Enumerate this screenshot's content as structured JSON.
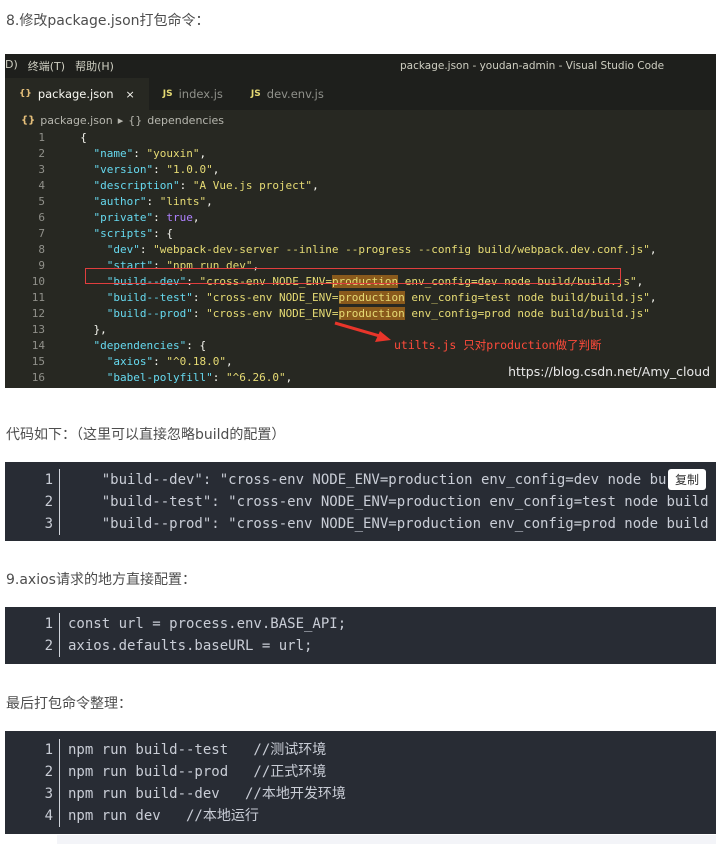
{
  "heading8": "8.修改package.json打包命令：",
  "vscode": {
    "menu": [
      "D)",
      "终端(T)",
      "帮助(H)"
    ],
    "window_title": "package.json - youdan-admin - Visual Studio Code",
    "tabs": [
      {
        "icon": "{}",
        "label": "package.json",
        "close": "×"
      },
      {
        "icon": "JS",
        "label": "index.js"
      },
      {
        "icon": "JS",
        "label": "dev.env.js"
      }
    ],
    "breadcrumb": {
      "file": "package.json",
      "sep": "▸",
      "node": "dependencies",
      "node_icon": "{}"
    },
    "line_numbers": [
      "1",
      "2",
      "3",
      "4",
      "5",
      "6",
      "7",
      "8",
      "9",
      "10",
      "11",
      "12",
      "13",
      "14",
      "15",
      "16"
    ],
    "lines": {
      "l1": "{",
      "l2_key": "\"name\"",
      "l2_val": "\"youxin\"",
      "l3_key": "\"version\"",
      "l3_val": "\"1.0.0\"",
      "l4_key": "\"description\"",
      "l4_val": "\"A Vue.js project\"",
      "l5_key": "\"author\"",
      "l5_val": "\"lints\"",
      "l6_key": "\"private\"",
      "l6_val": "true",
      "l7_key": "\"scripts\"",
      "l8_key": "\"dev\"",
      "l8_val": "\"webpack-dev-server --inline --progress --config build/webpack.dev.conf.js\"",
      "l9_key": "\"start\"",
      "l9_val": "\"npm run dev\"",
      "l10_key": "\"build--dev\"",
      "l10_a": "\"cross-env NODE_ENV=",
      "l10_hl": "production",
      "l10_b": " env_config=dev node build/build.js\"",
      "l11_key": "\"build--test\"",
      "l11_a": "\"cross-env NODE_ENV=",
      "l11_hl": "production",
      "l11_b": " env_config=test node build/build.js\"",
      "l12_key": "\"build--prod\"",
      "l12_a": "\"cross-env NODE_ENV=",
      "l12_hl": "production",
      "l12_b": " env_config=prod node build/build.js\"",
      "l13": "},",
      "l14_key": "\"dependencies\"",
      "l15_key": "\"axios\"",
      "l15_val": "\"^0.18.0\"",
      "l16_key": "\"babel-polyfill\"",
      "l16_val": "\"^6.26.0\""
    },
    "annotation": "utilts.js 只对production做了判断",
    "watermark": "https://blog.csdn.net/Amy_cloud"
  },
  "caption_code": "代码如下：（这里可以直接忽略build的配置）",
  "block1": {
    "copy_label": "复制",
    "lines": [
      {
        "n": "1",
        "t": "    \"build--dev\": \"cross-env NODE_ENV=production env_config=dev node bu"
      },
      {
        "n": "2",
        "t": "    \"build--test\": \"cross-env NODE_ENV=production env_config=test node build"
      },
      {
        "n": "3",
        "t": "    \"build--prod\": \"cross-env NODE_ENV=production env_config=prod node build"
      }
    ]
  },
  "heading9": "9.axios请求的地方直接配置：",
  "block2": {
    "lines": [
      {
        "n": "1",
        "t": "const url = process.env.BASE_API;"
      },
      {
        "n": "2",
        "t": "axios.defaults.baseURL = url;"
      }
    ]
  },
  "heading_last": "最后打包命令整理：",
  "block3": {
    "lines": [
      {
        "n": "1",
        "t": "npm run build--test   //测试环境"
      },
      {
        "n": "2",
        "t": "npm run build--prod   //正式环境"
      },
      {
        "n": "3",
        "t": "npm run build--dev   //本地开发环境"
      },
      {
        "n": "4",
        "t": "npm run dev   //本地运行"
      }
    ]
  }
}
